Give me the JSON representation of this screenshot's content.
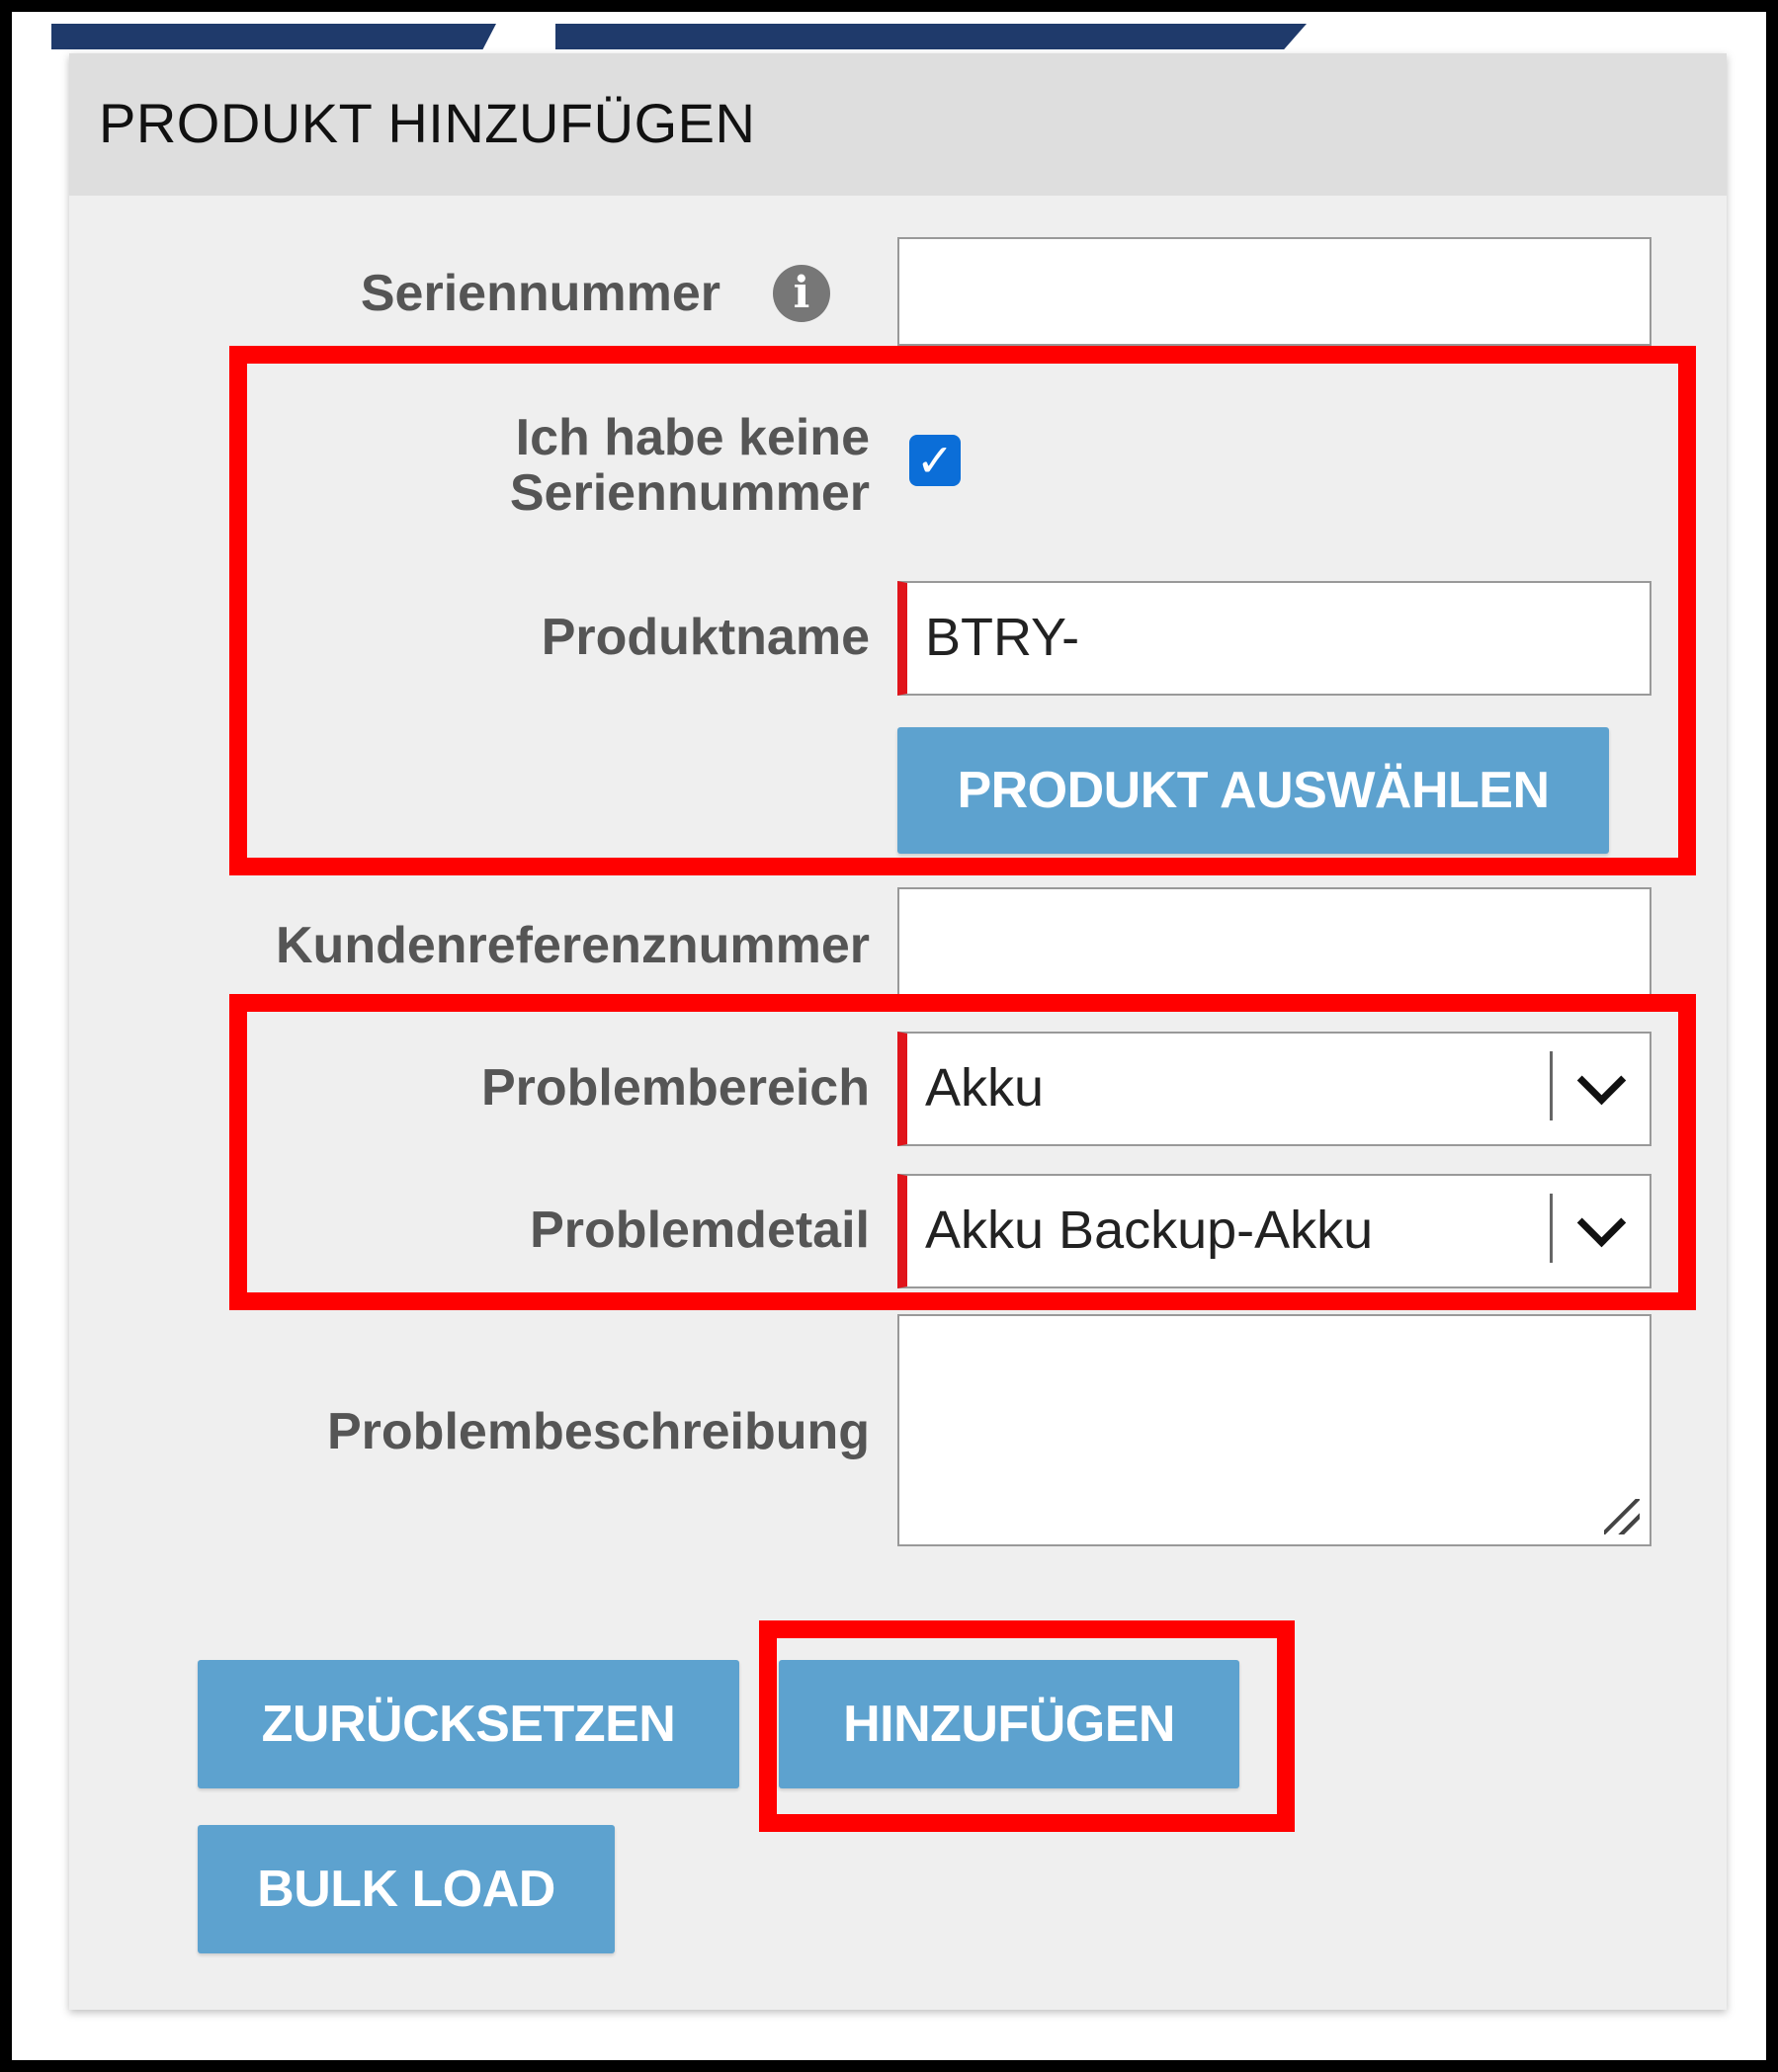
{
  "panel": {
    "title": "PRODUKT HINZUFÜGEN"
  },
  "form": {
    "serial_label": "Seriennummer",
    "serial_value": "",
    "no_serial_label_line1": "Ich habe keine",
    "no_serial_label_line2": "Seriennummer",
    "no_serial_checked": true,
    "product_name_label": "Produktname",
    "product_name_value": "BTRY-",
    "select_product_button": "PRODUKT AUSWÄHLEN",
    "customer_ref_label": "Kundenreferenznummer",
    "customer_ref_value": "",
    "problem_area_label": "Problembereich",
    "problem_area_value": "Akku",
    "problem_detail_label": "Problemdetail",
    "problem_detail_value": "Akku Backup-Akku",
    "problem_description_label": "Problembeschreibung",
    "problem_description_value": ""
  },
  "actions": {
    "reset": "ZURÜCKSETZEN",
    "add": "HINZUFÜGEN",
    "bulk_load": "BULK LOAD"
  },
  "icons": {
    "info": "info-icon",
    "checkbox": "checkmark-icon",
    "dropdown": "chevron-down-icon",
    "resize": "resize-grip-icon"
  },
  "colors": {
    "button": "#5da2cf",
    "required_marker": "#e0141b",
    "highlight": "#ff0000",
    "checkbox": "#0b6ed8",
    "header": "#1f3a6b"
  }
}
